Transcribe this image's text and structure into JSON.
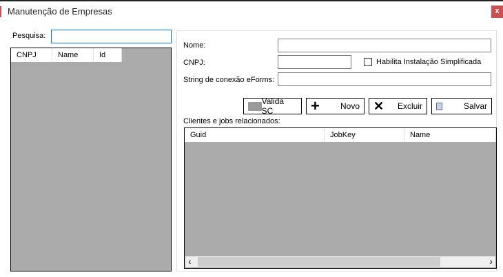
{
  "window": {
    "title": "Manutenção de Empresas",
    "close_label": "x"
  },
  "search": {
    "label": "Pesquisa:",
    "value": ""
  },
  "companies_grid": {
    "columns": [
      "CNPJ",
      "Name",
      "Id"
    ]
  },
  "form": {
    "nome_label": "Nome:",
    "nome_value": "",
    "cnpj_label": "CNPJ:",
    "cnpj_value": "",
    "checkbox_label": "Habilita Instalação Simplificada",
    "checkbox_checked": false,
    "string_label": "String de conexão eForms:",
    "string_value": ""
  },
  "buttons": {
    "valida": "Valida SC",
    "novo": "Novo",
    "excluir": "Excluir",
    "salvar": "Salvar"
  },
  "jobs": {
    "label": "Clientes e jobs relacionados:",
    "columns": [
      "Guid",
      "JobKey",
      "Name"
    ]
  },
  "scrollbar": {
    "left": "‹",
    "right": "›"
  }
}
